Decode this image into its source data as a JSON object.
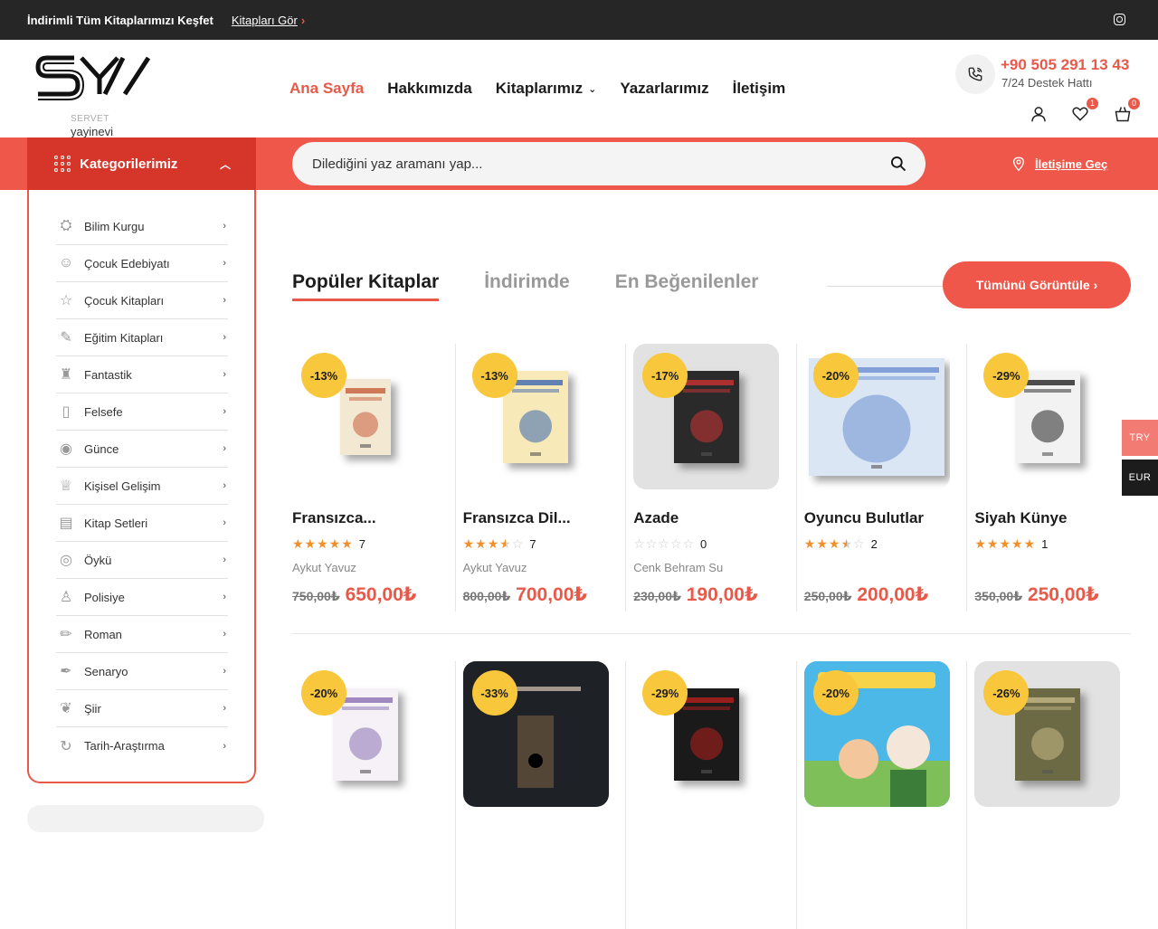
{
  "topbar": {
    "promo": "İndirimli Tüm Kitaplarımızı Keşfet",
    "promo_link": "Kitapları Gör"
  },
  "logo": {
    "line1": "SERVET",
    "line2": "yayinevi"
  },
  "nav": [
    {
      "label": "Ana Sayfa",
      "active": true
    },
    {
      "label": "Hakkımızda"
    },
    {
      "label": "Kitaplarımız",
      "dropdown": true
    },
    {
      "label": "Yazarlarımız"
    },
    {
      "label": "İletişim"
    }
  ],
  "phone": {
    "number": "+90 505 291 13 43",
    "sub": "7/24 Destek Hattı"
  },
  "header_icons": {
    "wishlist_count": "1",
    "cart_count": "0"
  },
  "categories_title": "Kategorilerimiz",
  "search": {
    "placeholder": "Dilediğini yaz aramanı yap..."
  },
  "contact_link": "İletişime Geç",
  "categories": [
    {
      "label": "Bilim Kurgu",
      "icon": "ufo-icon"
    },
    {
      "label": "Çocuk Edebiyatı",
      "icon": "child-face-icon"
    },
    {
      "label": "Çocuk Kitapları",
      "icon": "star-icon"
    },
    {
      "label": "Eğitim Kitapları",
      "icon": "education-icon"
    },
    {
      "label": "Fantastik",
      "icon": "castle-icon"
    },
    {
      "label": "Felsefe",
      "icon": "book-page-icon"
    },
    {
      "label": "Günce",
      "icon": "eye-icon"
    },
    {
      "label": "Kişisel Gelişim",
      "icon": "trophy-icon"
    },
    {
      "label": "Kitap Setleri",
      "icon": "book-set-icon"
    },
    {
      "label": "Öykü",
      "icon": "watching-eye-icon"
    },
    {
      "label": "Polisiye",
      "icon": "detective-icon"
    },
    {
      "label": "Roman",
      "icon": "pencil-icon"
    },
    {
      "label": "Senaryo",
      "icon": "script-pen-icon"
    },
    {
      "label": "Şiir",
      "icon": "feather-icon"
    },
    {
      "label": "Tarih-Araştırma",
      "icon": "history-icon"
    }
  ],
  "tabs": [
    {
      "label": "Popüler Kitaplar",
      "active": true
    },
    {
      "label": "İndirimde"
    },
    {
      "label": "En Beğenilenler"
    }
  ],
  "view_all": "Tümünü Görüntüle",
  "products_row1": [
    {
      "discount": "-13%",
      "title": "Fransızca...",
      "rating": 5,
      "reviews": "7",
      "author": "Aykut Yavuz",
      "old_price": "750,00₺",
      "new_price": "650,00₺",
      "cover": "#f3e8d2",
      "accent": "#c65d3b",
      "bg": "plain"
    },
    {
      "discount": "-13%",
      "title": "Fransızca Dil...",
      "rating": 3.5,
      "reviews": "7",
      "author": "Aykut Yavuz",
      "old_price": "800,00₺",
      "new_price": "700,00₺",
      "cover": "#f7e9b8",
      "accent": "#3b67b0",
      "bg": "plain"
    },
    {
      "discount": "-17%",
      "title": "Azade",
      "rating": 0,
      "reviews": "0",
      "author": "Cenk Behram Su",
      "old_price": "230,00₺",
      "new_price": "190,00₺",
      "cover": "#2a2a2a",
      "accent": "#c33",
      "bg": "grey"
    },
    {
      "discount": "-20%",
      "title": "Oyuncu Bulutlar",
      "rating": 3.5,
      "reviews": "2",
      "author": "",
      "old_price": "250,00₺",
      "new_price": "200,00₺",
      "cover": "#dbe6f5",
      "accent": "#6b8fd0",
      "bg": "plain"
    },
    {
      "discount": "-29%",
      "title": "Siyah Künye",
      "rating": 5,
      "reviews": "1",
      "author": "",
      "old_price": "350,00₺",
      "new_price": "250,00₺",
      "cover": "#f2f2f2",
      "accent": "#222",
      "bg": "plain"
    }
  ],
  "products_row2": [
    {
      "discount": "-20%",
      "cover": "#f5f1f6",
      "accent": "#8a6fb3",
      "bg": "plain"
    },
    {
      "discount": "-33%",
      "cover": "#1e2226",
      "accent": "#8a6a45",
      "bg": "tan"
    },
    {
      "discount": "-29%",
      "cover": "#1a1a1a",
      "accent": "#b5201d",
      "bg": "plain"
    },
    {
      "discount": "-20%",
      "cover": "#4bb8e8",
      "accent": "#6b3a23",
      "bg": "plain"
    },
    {
      "discount": "-26%",
      "cover": "#6b6a45",
      "accent": "#c8b887",
      "bg": "grey"
    }
  ],
  "currencies": [
    "TRY",
    "EUR"
  ],
  "colors": {
    "accent": "#e8594a",
    "red_bar": "#f0574b",
    "category_head": "#d6352a",
    "discount_badge": "#f9c73b"
  }
}
